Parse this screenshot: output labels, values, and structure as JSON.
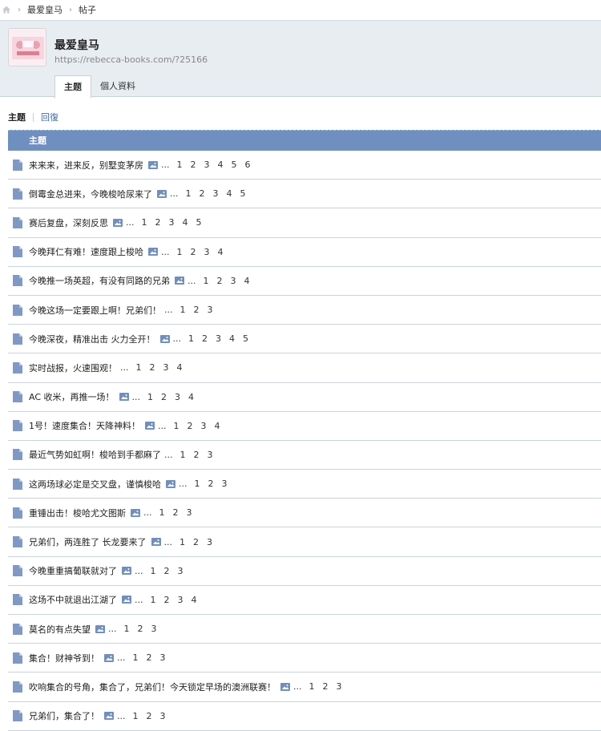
{
  "breadcrumb": {
    "items": [
      "最爱皇马",
      "帖子"
    ]
  },
  "header": {
    "site_name": "最爱皇马",
    "site_url": "https://rebecca-books.com/?25166"
  },
  "tabs": [
    {
      "label": "主题",
      "active": true
    },
    {
      "label": "個人資料",
      "active": false
    }
  ],
  "subnav": {
    "current": "主题",
    "link": "回復"
  },
  "list": {
    "heading": "主题",
    "rows": [
      {
        "title": "来来来，进来反，别墅变茅房",
        "image": true,
        "pages": [
          "1",
          "2",
          "3",
          "4",
          "5",
          "6"
        ]
      },
      {
        "title": "倒霉金总进来，今晚梭哈尿来了",
        "image": true,
        "pages": [
          "1",
          "2",
          "3",
          "4",
          "5"
        ]
      },
      {
        "title": "赛后复盘，深刻反思",
        "image": true,
        "pages": [
          "1",
          "2",
          "3",
          "4",
          "5"
        ]
      },
      {
        "title": "今晚拜仁有难！速度跟上梭哈",
        "image": true,
        "pages": [
          "1",
          "2",
          "3",
          "4"
        ]
      },
      {
        "title": "今晚推一场英超，有没有同路的兄弟",
        "image": true,
        "pages": [
          "1",
          "2",
          "3",
          "4"
        ]
      },
      {
        "title": "今晚这场一定要跟上啊！兄弟们！",
        "image": false,
        "pages": [
          "1",
          "2",
          "3"
        ]
      },
      {
        "title": "今晚深夜，精准出击 火力全开！",
        "image": true,
        "pages": [
          "1",
          "2",
          "3",
          "4",
          "5"
        ]
      },
      {
        "title": "实时战报，火速围观！",
        "image": false,
        "pages": [
          "1",
          "2",
          "3",
          "4"
        ]
      },
      {
        "title": "AC 收米，再推一场！",
        "image": true,
        "pages": [
          "1",
          "2",
          "3",
          "4"
        ]
      },
      {
        "title": "1号！速度集合！天降神料！",
        "image": true,
        "pages": [
          "1",
          "2",
          "3",
          "4"
        ]
      },
      {
        "title": "最近气势如虹啊！梭哈到手都麻了",
        "image": false,
        "pages": [
          "1",
          "2",
          "3"
        ]
      },
      {
        "title": "这两场球必定是交叉盘，谨慎梭哈",
        "image": true,
        "pages": [
          "1",
          "2",
          "3"
        ]
      },
      {
        "title": "重锤出击！梭哈尤文图斯",
        "image": true,
        "pages": [
          "1",
          "2",
          "3"
        ]
      },
      {
        "title": "兄弟们，两连胜了 长龙要来了",
        "image": true,
        "pages": [
          "1",
          "2",
          "3"
        ]
      },
      {
        "title": "今晚重重搞葡联就对了",
        "image": true,
        "pages": [
          "1",
          "2",
          "3"
        ]
      },
      {
        "title": "这场不中就退出江湖了",
        "image": true,
        "pages": [
          "1",
          "2",
          "3",
          "4"
        ]
      },
      {
        "title": "莫名的有点失望",
        "image": true,
        "pages": [
          "1",
          "2",
          "3"
        ]
      },
      {
        "title": "集合！财神爷到！",
        "image": true,
        "pages": [
          "1",
          "2",
          "3"
        ]
      },
      {
        "title": "吹响集合的号角，集合了，兄弟们！今天锁定早场的澳洲联赛！",
        "image": true,
        "pages": [
          "1",
          "2",
          "3"
        ]
      },
      {
        "title": "兄弟们，集合了！",
        "image": true,
        "pages": [
          "1",
          "2",
          "3"
        ]
      }
    ]
  }
}
